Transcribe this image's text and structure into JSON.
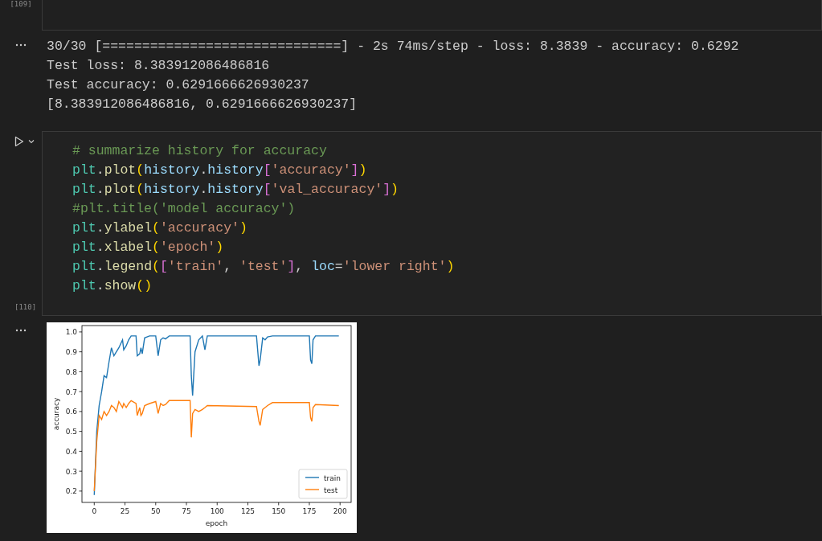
{
  "cells": [
    {
      "kind": "stub",
      "execution_count": "[109]"
    },
    {
      "kind": "output-text",
      "lines": [
        "30/30 [==============================] - 2s 74ms/step - loss: 8.3839 - accuracy: 0.6292",
        "Test loss: 8.383912086486816",
        "Test accuracy: 0.6291666626930237",
        "[8.383912086486816, 0.6291666626930237]"
      ]
    },
    {
      "kind": "code",
      "execution_count": "[110]",
      "lines": [
        [
          {
            "t": "# summarize history for accuracy",
            "kind": "comment"
          }
        ],
        [
          {
            "t": "plt",
            "kind": "module"
          },
          {
            "t": ".",
            "kind": "punct"
          },
          {
            "t": "plot",
            "kind": "method"
          },
          {
            "t": "(",
            "kind": "paren"
          },
          {
            "t": "history",
            "kind": "var"
          },
          {
            "t": ".",
            "kind": "punct"
          },
          {
            "t": "history",
            "kind": "var"
          },
          {
            "t": "[",
            "kind": "bracket"
          },
          {
            "t": "'accuracy'",
            "kind": "string"
          },
          {
            "t": "]",
            "kind": "bracket"
          },
          {
            "t": ")",
            "kind": "paren"
          }
        ],
        [
          {
            "t": "plt",
            "kind": "module"
          },
          {
            "t": ".",
            "kind": "punct"
          },
          {
            "t": "plot",
            "kind": "method"
          },
          {
            "t": "(",
            "kind": "paren"
          },
          {
            "t": "history",
            "kind": "var"
          },
          {
            "t": ".",
            "kind": "punct"
          },
          {
            "t": "history",
            "kind": "var"
          },
          {
            "t": "[",
            "kind": "bracket"
          },
          {
            "t": "'val_accuracy'",
            "kind": "string"
          },
          {
            "t": "]",
            "kind": "bracket"
          },
          {
            "t": ")",
            "kind": "paren"
          }
        ],
        [
          {
            "t": "#plt.title('model accuracy')",
            "kind": "comment"
          }
        ],
        [
          {
            "t": "plt",
            "kind": "module"
          },
          {
            "t": ".",
            "kind": "punct"
          },
          {
            "t": "ylabel",
            "kind": "method"
          },
          {
            "t": "(",
            "kind": "paren"
          },
          {
            "t": "'accuracy'",
            "kind": "string"
          },
          {
            "t": ")",
            "kind": "paren"
          }
        ],
        [
          {
            "t": "plt",
            "kind": "module"
          },
          {
            "t": ".",
            "kind": "punct"
          },
          {
            "t": "xlabel",
            "kind": "method"
          },
          {
            "t": "(",
            "kind": "paren"
          },
          {
            "t": "'epoch'",
            "kind": "string"
          },
          {
            "t": ")",
            "kind": "paren"
          }
        ],
        [
          {
            "t": "plt",
            "kind": "module"
          },
          {
            "t": ".",
            "kind": "punct"
          },
          {
            "t": "legend",
            "kind": "method"
          },
          {
            "t": "(",
            "kind": "paren"
          },
          {
            "t": "[",
            "kind": "bracket"
          },
          {
            "t": "'train'",
            "kind": "string"
          },
          {
            "t": ", ",
            "kind": "punct"
          },
          {
            "t": "'test'",
            "kind": "string"
          },
          {
            "t": "]",
            "kind": "bracket"
          },
          {
            "t": ", ",
            "kind": "punct"
          },
          {
            "t": "loc",
            "kind": "var"
          },
          {
            "t": "=",
            "kind": "punct"
          },
          {
            "t": "'lower right'",
            "kind": "string"
          },
          {
            "t": ")",
            "kind": "paren"
          }
        ],
        [
          {
            "t": "plt",
            "kind": "module"
          },
          {
            "t": ".",
            "kind": "punct"
          },
          {
            "t": "show",
            "kind": "method"
          },
          {
            "t": "()",
            "kind": "paren"
          }
        ]
      ]
    },
    {
      "kind": "output-chart",
      "chart_data": {
        "type": "line",
        "xlabel": "epoch",
        "ylabel": "accuracy",
        "x": [
          0,
          2,
          4,
          6,
          8,
          10,
          12,
          14,
          16,
          18,
          20,
          23,
          24,
          26,
          28,
          30,
          34,
          35,
          37,
          38,
          39,
          41,
          45,
          50,
          52,
          54,
          56,
          58,
          61,
          78,
          79,
          80,
          82,
          85,
          88,
          90,
          92,
          132,
          134,
          135,
          137,
          139,
          141,
          145,
          175,
          176,
          177,
          178,
          180,
          199
        ],
        "series": [
          {
            "name": "train",
            "color": "#1f77b4",
            "values": [
              0.18,
              0.5,
              0.63,
              0.7,
              0.78,
              0.77,
              0.85,
              0.92,
              0.88,
              0.9,
              0.92,
              0.96,
              0.91,
              0.93,
              0.96,
              0.98,
              0.98,
              0.88,
              0.89,
              0.92,
              0.89,
              0.97,
              0.98,
              0.98,
              0.88,
              0.96,
              0.97,
              0.965,
              0.98,
              0.98,
              0.78,
              0.68,
              0.9,
              0.96,
              0.98,
              0.91,
              0.98,
              0.98,
              0.83,
              0.86,
              0.97,
              0.96,
              0.975,
              0.98,
              0.98,
              0.86,
              0.84,
              0.96,
              0.98,
              0.98
            ]
          },
          {
            "name": "test",
            "color": "#ff7f0e",
            "values": [
              0.2,
              0.45,
              0.58,
              0.56,
              0.6,
              0.58,
              0.6,
              0.63,
              0.62,
              0.6,
              0.65,
              0.62,
              0.64,
              0.62,
              0.64,
              0.655,
              0.64,
              0.58,
              0.62,
              0.58,
              0.59,
              0.63,
              0.64,
              0.65,
              0.59,
              0.64,
              0.63,
              0.635,
              0.655,
              0.655,
              0.47,
              0.59,
              0.61,
              0.6,
              0.61,
              0.62,
              0.63,
              0.625,
              0.55,
              0.53,
              0.61,
              0.62,
              0.63,
              0.645,
              0.645,
              0.57,
              0.55,
              0.62,
              0.635,
              0.63
            ]
          }
        ],
        "legend": "lower right",
        "xlim": [
          -10,
          209
        ],
        "ylim": [
          0.143,
          1.032
        ],
        "xticks": [
          0,
          25,
          50,
          75,
          100,
          125,
          150,
          175,
          200
        ],
        "yticks": [
          0.2,
          0.3,
          0.4,
          0.5,
          0.6,
          0.7,
          0.8,
          0.9,
          {
            "value": 1,
            "label": "1.0"
          }
        ]
      }
    }
  ]
}
